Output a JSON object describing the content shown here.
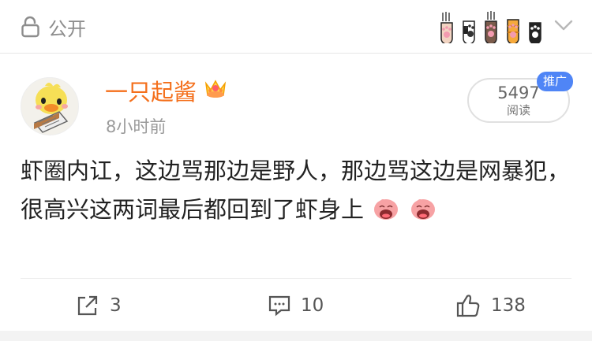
{
  "topbar": {
    "visibility_label": "公开"
  },
  "post": {
    "username": "一只起酱",
    "timestamp": "8小时前",
    "read_count": "5497",
    "read_label": "阅读",
    "promo_badge": "推广",
    "text": "虾圈内讧，这边骂那边是野人，那边骂这边是网暴犯，很高兴这两词最后都回到了虾身上"
  },
  "actions": {
    "share_count": "3",
    "comment_count": "10",
    "like_count": "138"
  },
  "colors": {
    "username": "#f46f1b",
    "promo_badge": "#4f85f6",
    "muted": "#9b9b9b"
  }
}
